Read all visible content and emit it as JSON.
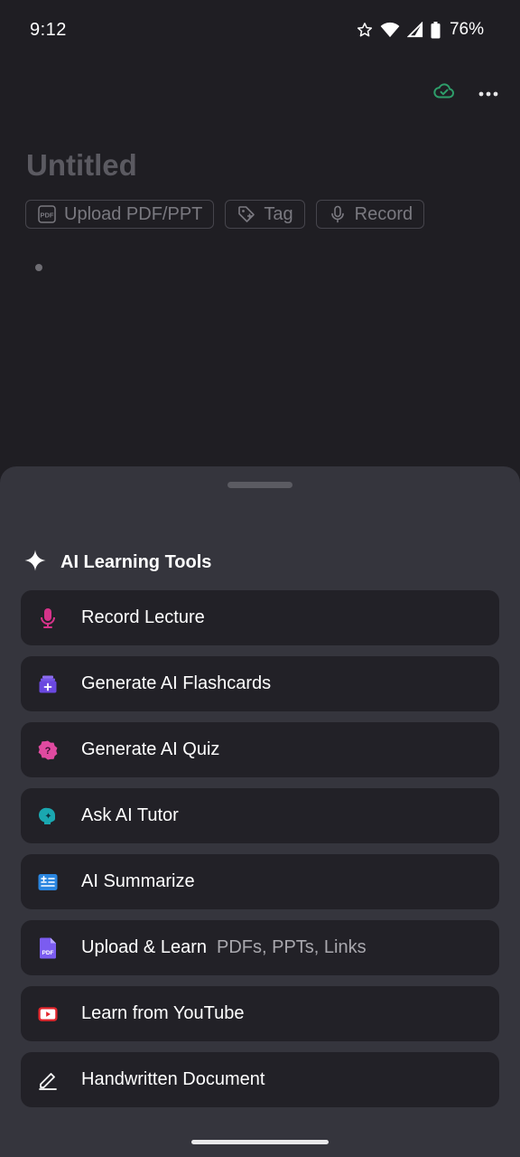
{
  "status": {
    "time": "9:12",
    "battery": "76%"
  },
  "note": {
    "title": "Untitled",
    "chips": [
      {
        "label": "Upload PDF/PPT",
        "icon": "pdf-icon"
      },
      {
        "label": "Tag",
        "icon": "tag-icon"
      },
      {
        "label": "Record",
        "icon": "microphone-icon"
      }
    ]
  },
  "sheet": {
    "title": "AI Learning Tools",
    "tools": [
      {
        "label": "Record Lecture",
        "sub": "",
        "icon": "microphone-icon"
      },
      {
        "label": "Generate AI Flashcards",
        "sub": "",
        "icon": "flashcards-icon"
      },
      {
        "label": "Generate AI Quiz",
        "sub": "",
        "icon": "quiz-icon"
      },
      {
        "label": "Ask AI Tutor",
        "sub": "",
        "icon": "tutor-icon"
      },
      {
        "label": "AI Summarize",
        "sub": "",
        "icon": "summarize-icon"
      },
      {
        "label": "Upload & Learn",
        "sub": "PDFs, PPTs, Links",
        "icon": "pdf-file-icon"
      },
      {
        "label": "Learn from YouTube",
        "sub": "",
        "icon": "youtube-icon"
      },
      {
        "label": "Handwritten Document",
        "sub": "",
        "icon": "pen-icon"
      }
    ]
  },
  "colors": {
    "background": "#1f1e23",
    "sheet": "#35353d",
    "card": "#222127",
    "sync_green": "#2e9e6a"
  }
}
